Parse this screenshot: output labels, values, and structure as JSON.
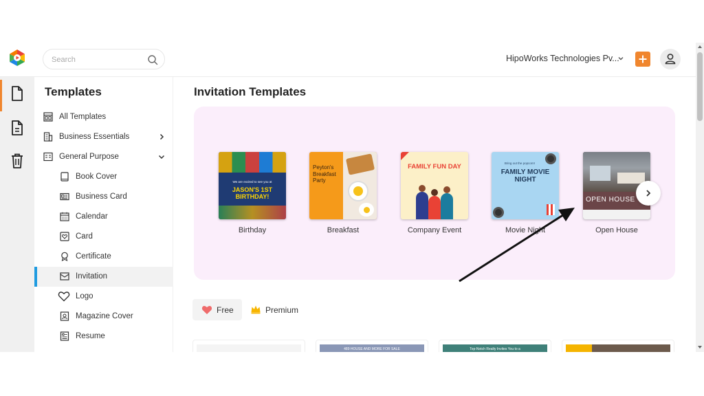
{
  "search": {
    "placeholder": "Search"
  },
  "header": {
    "account_name": "HipoWorks Technologies Pv..."
  },
  "sidebar": {
    "title": "Templates",
    "items": [
      {
        "label": "All Templates",
        "icon": "layout-icon"
      },
      {
        "label": "Business Essentials",
        "icon": "building-icon"
      },
      {
        "label": "General Purpose",
        "icon": "form-icon"
      },
      {
        "label": "Book Cover",
        "icon": "book-icon"
      },
      {
        "label": "Business Card",
        "icon": "id-card-icon"
      },
      {
        "label": "Calendar",
        "icon": "calendar-icon"
      },
      {
        "label": "Card",
        "icon": "heart-card-icon"
      },
      {
        "label": "Certificate",
        "icon": "badge-icon"
      },
      {
        "label": "Invitation",
        "icon": "invitation-icon"
      },
      {
        "label": "Logo",
        "icon": "heart-icon"
      },
      {
        "label": "Magazine Cover",
        "icon": "magazine-icon"
      },
      {
        "label": "Resume",
        "icon": "resume-icon"
      }
    ],
    "active": "Invitation"
  },
  "main": {
    "title": "Invitation Templates",
    "templates": [
      {
        "name": "Birthday",
        "thumb_line1": "We are excited to see you at",
        "thumb_title": "JASON'S 1ST BIRTHDAY!"
      },
      {
        "name": "Breakfast",
        "thumb_title": "Peyton's Breakfast Party"
      },
      {
        "name": "Company Event",
        "thumb_title": "FAMILY FUN DAY"
      },
      {
        "name": "Movie Night",
        "thumb_line1": "Bring out the popcorn!",
        "thumb_title": "FAMILY MOVIE NIGHT"
      },
      {
        "name": "Open House",
        "thumb_title": "OPEN HOUSE"
      }
    ],
    "filters": {
      "free": "Free",
      "premium": "Premium"
    },
    "grid_cards": [
      {
        "band": ""
      },
      {
        "band": "489 HOUSE AND MORE FOR SALE"
      },
      {
        "band": "Top-Notch Realty Invites You to a"
      },
      {
        "band": ""
      }
    ]
  },
  "colors": {
    "accent": "#f0862e",
    "active_indicator": "#1f9be0",
    "carousel_bg": "#fbeefb"
  }
}
